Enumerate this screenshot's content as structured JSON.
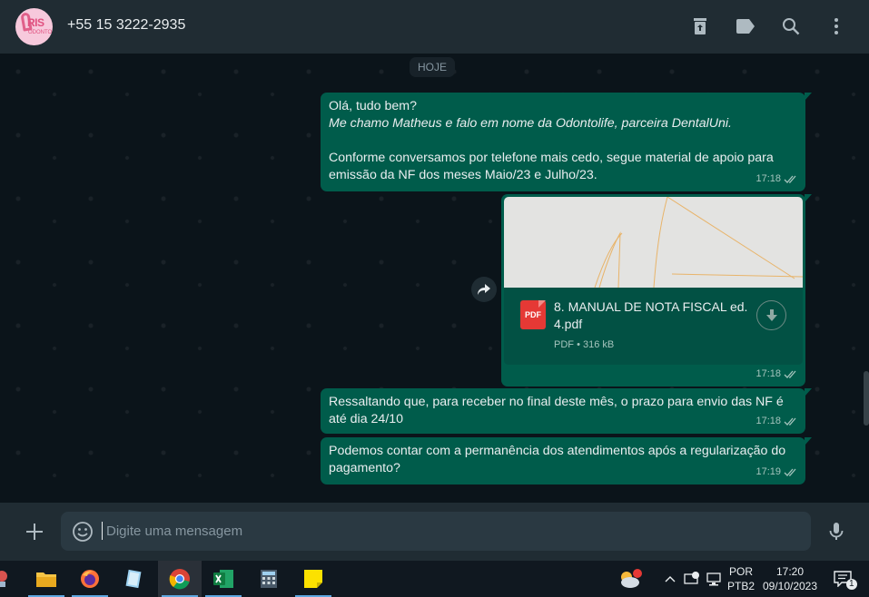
{
  "header": {
    "contact_name": "+55 15 3222-2935",
    "avatar_text": "RIS",
    "avatar_sub": "ODONTO"
  },
  "chat": {
    "date_chip": "HOJE",
    "messages": [
      {
        "lines": [
          "Olá, tudo bem?",
          "Me chamo Matheus e falo em nome da Odontolife, parceira DentalUni.",
          "",
          "Conforme conversamos por telefone mais cedo, segue material de apoio para",
          "emissão da NF dos meses Maio/23 e Julho/23."
        ],
        "time": "17:18"
      },
      {
        "file_name": "8. MANUAL DE NOTA FISCAL ed. 4.pdf",
        "file_type": "PDF",
        "file_badge": "PDF",
        "file_size": "316 kB",
        "file_meta_sep": "•",
        "time": "17:18"
      },
      {
        "text": "Ressaltando que, para receber no final deste mês, o prazo para envio das NF é até dia 24/10",
        "time": "17:18"
      },
      {
        "text": "Podemos contar com a permanência dos atendimentos após a regularização do pagamento?",
        "time": "17:19"
      }
    ]
  },
  "composer": {
    "placeholder": "Digite uma mensagem"
  },
  "taskbar": {
    "lang_top": "POR",
    "lang_bottom": "PTB2",
    "time": "17:20",
    "date": "09/10/2023",
    "notification_count": "1"
  },
  "colors": {
    "bubble_out": "#005c4b",
    "header": "#202c33",
    "chat_bg": "#0b141a"
  }
}
